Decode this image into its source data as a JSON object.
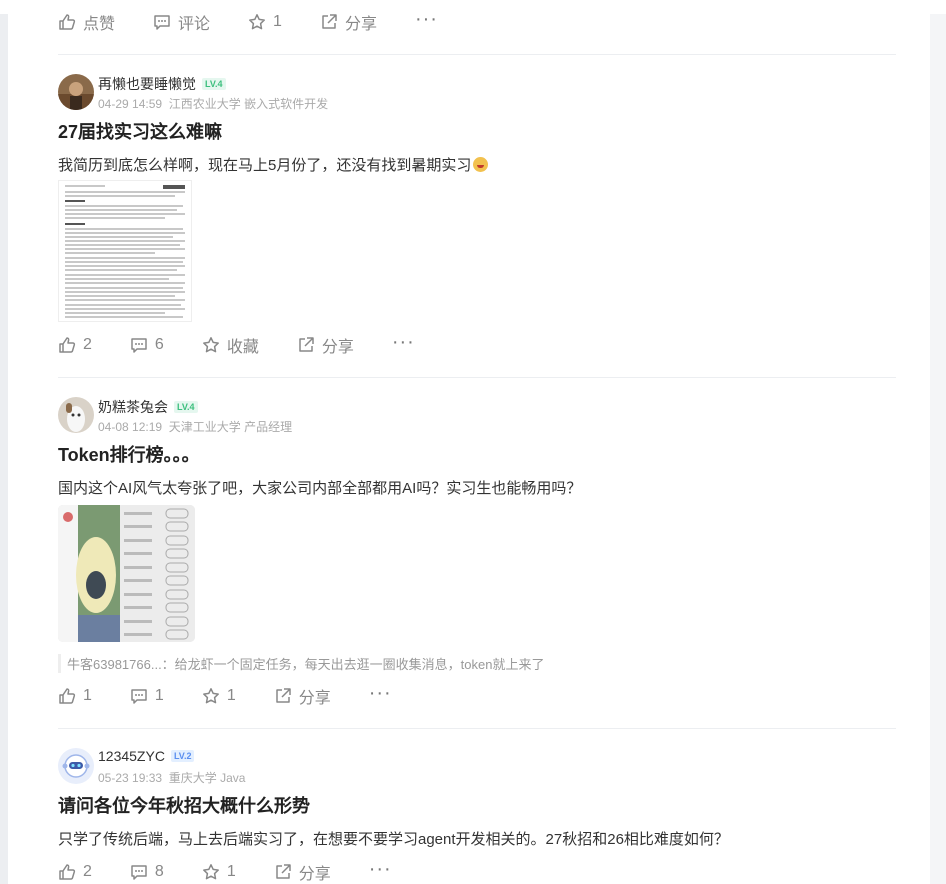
{
  "posts": [
    {
      "author": "",
      "actions": {
        "like": "点赞",
        "comment": "评论",
        "star": "1",
        "share": "分享",
        "more": "···"
      }
    },
    {
      "author": "再懒也要睡懒觉",
      "level": "LV.4",
      "date": "04-29 14:59",
      "meta": "江西农业大学 嵌入式软件开发",
      "title": "27届找实习这么难嘛",
      "body": "我简历到底怎么样啊，现在马上5月份了，还没有找到暑期实习",
      "actions": {
        "like": "2",
        "comment": "6",
        "star": "收藏",
        "share": "分享",
        "more": "···"
      }
    },
    {
      "author": "奶糕茶兔会",
      "level": "LV.4",
      "date": "04-08 12:19",
      "meta": "天津工业大学 产品经理",
      "title": "Token排行榜。。。",
      "body": "国内这个AI风气太夸张了吧，大家公司内部全部都用AI吗？实习生也能畅用吗？",
      "comment_preview": "牛客63981766...：给龙虾一个固定任务，每天出去逛一圈收集消息，token就上来了",
      "actions": {
        "like": "1",
        "comment": "1",
        "star": "1",
        "share": "分享",
        "more": "···"
      }
    },
    {
      "author": "12345ZYC",
      "level": "LV.2",
      "date": "05-23 19:33",
      "meta": "重庆大学 Java",
      "title": "请问各位今年秋招大概什么形势",
      "body": "只学了传统后端，马上去后端实习了，在想要不要学习agent开发相关的。27秋招和26相比难度如何？",
      "actions": {
        "like": "2",
        "comment": "8",
        "star": "1",
        "share": "分享",
        "more": "···"
      }
    }
  ],
  "colors": {
    "level_green": "#3cbf7e",
    "level_blue": "#5b8ff0",
    "muted": "#888888"
  }
}
